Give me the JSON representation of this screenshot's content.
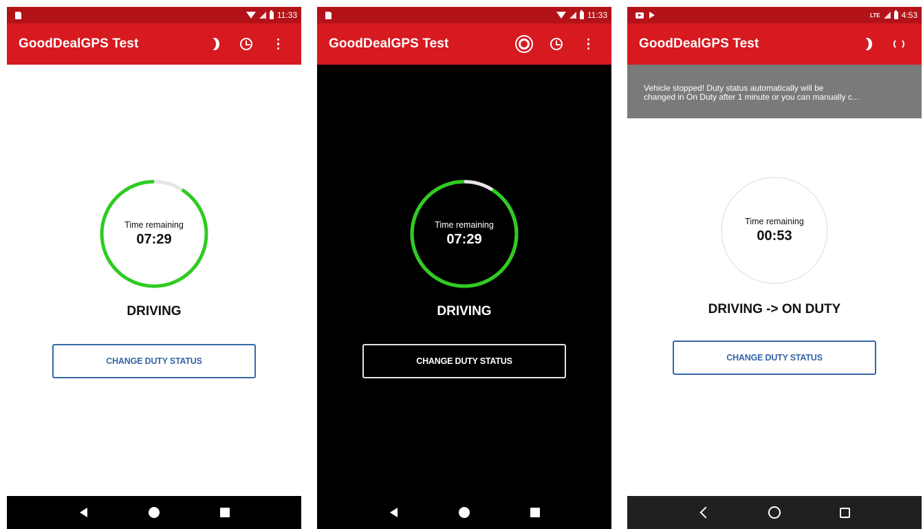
{
  "colors": {
    "status_bar": "#b31318",
    "app_bar": "#d71920",
    "progress_green": "#2ecc1f",
    "progress_track": "#e6e6e6",
    "button_blue": "#3566a8",
    "banner_gray": "#7a7a7a"
  },
  "screens": [
    {
      "theme": "light",
      "status_bar": {
        "left_icons": [
          "sd-card-icon"
        ],
        "right_icons": [
          "wifi-icon",
          "signal-icon",
          "battery-icon"
        ],
        "time": "11:33"
      },
      "app_bar": {
        "title": "GoodDealGPS Test",
        "actions": [
          "moon-icon",
          "alarm-clock-icon",
          "overflow-menu-icon"
        ]
      },
      "timer": {
        "label": "Time remaining",
        "value": "07:29",
        "progress_fraction": 0.91,
        "progress_color": "#2ecc1f"
      },
      "duty_status": "DRIVING",
      "button_label": "CHANGE DUTY STATUS",
      "nav": [
        "back-icon",
        "home-icon",
        "recents-icon"
      ]
    },
    {
      "theme": "dark",
      "status_bar": {
        "left_icons": [
          "sd-card-icon"
        ],
        "right_icons": [
          "wifi-icon",
          "signal-icon",
          "battery-icon"
        ],
        "time": "11:33"
      },
      "app_bar": {
        "title": "GoodDealGPS Test",
        "actions": [
          "sun-icon",
          "alarm-clock-icon",
          "overflow-menu-icon"
        ]
      },
      "timer": {
        "label": "Time remaining",
        "value": "07:29",
        "progress_fraction": 0.91,
        "progress_color": "#2ecc1f"
      },
      "duty_status": "DRIVING",
      "button_label": "CHANGE DUTY STATUS",
      "nav": [
        "back-icon",
        "home-icon",
        "recents-icon"
      ]
    },
    {
      "theme": "light",
      "status_bar": {
        "left_icons": [
          "youtube-icon",
          "play-store-icon"
        ],
        "right_icons": [
          "lte-signal-icon",
          "battery-icon"
        ],
        "lte_label": "LTE",
        "time": "4:53"
      },
      "app_bar": {
        "title": "GoodDealGPS Test",
        "actions": [
          "moon-icon",
          "sync-icon"
        ]
      },
      "banner": {
        "line1": "Vehicle stopped! Duty status automatically will be",
        "line2": "changed in On Duty after 1 minute or you can manually c..."
      },
      "timer": {
        "label": "Time remaining",
        "value": "00:53",
        "progress_fraction": 0,
        "progress_color": "#2ecc1f"
      },
      "duty_status": "DRIVING -> ON DUTY",
      "button_label": "CHANGE DUTY STATUS",
      "nav": [
        "back-outline-icon",
        "home-outline-icon",
        "recents-outline-icon"
      ]
    }
  ]
}
